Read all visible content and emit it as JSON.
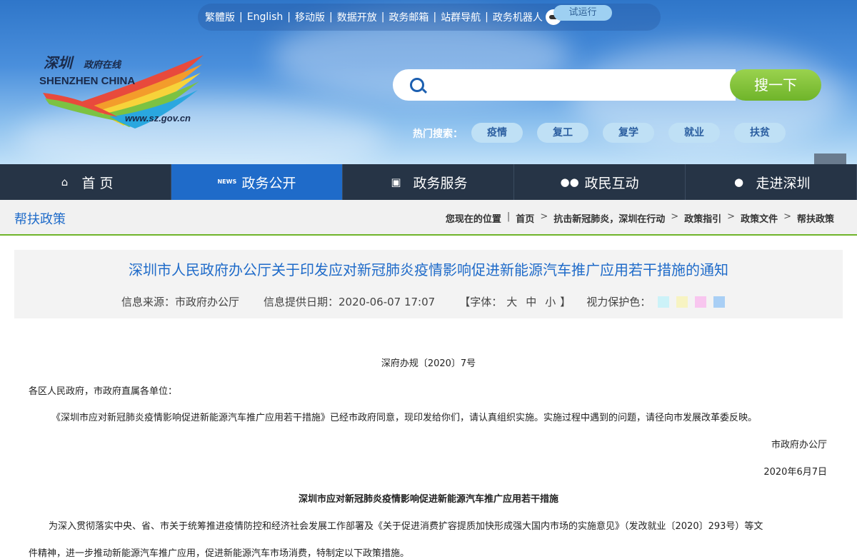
{
  "toplinks": [
    "繁體版",
    "English",
    "移动版",
    "数据开放",
    "政务邮箱",
    "站群导航",
    "政务机器人"
  ],
  "trial_label": "试运行",
  "logo": {
    "cn": "深圳",
    "cn_small": "政府在线",
    "en": "SHENZHEN CHINA",
    "url": "www.sz.gov.cn"
  },
  "search": {
    "placeholder": "",
    "button_label": "搜一下"
  },
  "hot": {
    "label": "热门搜索：",
    "tags": [
      "疫情",
      "复工",
      "复学",
      "就业",
      "扶贫"
    ]
  },
  "nav": [
    {
      "label": "首 页",
      "icon": "home-icon"
    },
    {
      "label": "政务公开",
      "icon": "news-icon"
    },
    {
      "label": "政务服务",
      "icon": "monitor-icon"
    },
    {
      "label": "政民互动",
      "icon": "users-icon"
    },
    {
      "label": "走进深圳",
      "icon": "chat-icon"
    }
  ],
  "section_title": "帮扶政策",
  "breadcrumb": [
    "您现在的位置",
    "首页",
    "抗击新冠肺炎，深圳在行动",
    "政策指引",
    "政策文件",
    "帮扶政策"
  ],
  "article": {
    "title": "深圳市人民政府办公厅关于印发应对新冠肺炎疫情影响促进新能源汽车推广应用若干措施的通知",
    "source": "信息来源：市政府办公厅",
    "date": "信息提供日期：2020-06-07 17:07",
    "font_open": "【字体：",
    "font_large": "大",
    "font_medium": "中",
    "font_small": "小",
    "font_close": "】",
    "eye_label": "视力保护色：",
    "eye_colors": [
      "#ccf2f8",
      "#f7f3c2",
      "#f8c6ef",
      "#a9cff5"
    ]
  },
  "body": {
    "doc_no": "深府办规〔2020〕7号",
    "salutation": "各区人民政府，市政府直属各单位：",
    "para1": "《深圳市应对新冠肺炎疫情影响促进新能源汽车推广应用若干措施》已经市政府同意，现印发给你们，请认真组织实施。实施过程中遇到的问题，请径向市发展改革委反映。",
    "signer": "市政府办公厅",
    "sign_date": "2020年6月7日",
    "subtitle": "深圳市应对新冠肺炎疫情影响促进新能源汽车推广应用若干措施",
    "para2_line1": "为深入贯彻落实中央、省、市关于统筹推进疫情防控和经济社会发展工作部署及《关于促进消费扩容提质加快形成强大国内市场的实施意见》（发改就业〔2020〕293号）等文",
    "para2_line2": "件精神，进一步推动新能源汽车推广应用，促进新能源汽车市场消费，特制定以下政策措施。"
  }
}
